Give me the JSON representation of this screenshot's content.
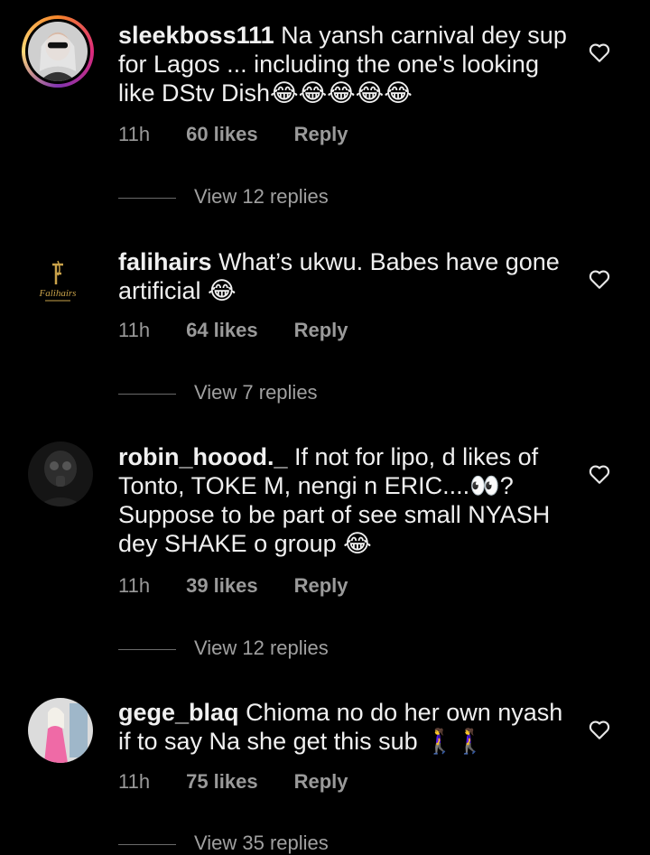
{
  "comments": [
    {
      "username": "sleekboss111",
      "text": "Na yansh carnival dey sup for Lagos ... including the one's looking like DStv Dish😂😂😂😂😂",
      "time": "11h",
      "likes": "60 likes",
      "reply": "Reply",
      "view_replies": "View 12 replies"
    },
    {
      "username": "falihairs",
      "text": "What’s ukwu. Babes have gone artificial 😂",
      "time": "11h",
      "likes": "64 likes",
      "reply": "Reply",
      "view_replies": "View 7 replies",
      "avatar_text": "Falihairs"
    },
    {
      "username": "robin_hoood._",
      "text": "If not for lipo, d likes of Tonto, TOKE M, nengi n ERIC....👀? Suppose to be part of see small NYASH dey SHAKE o group 😂",
      "time": "11h",
      "likes": "39 likes",
      "reply": "Reply",
      "view_replies": "View 12 replies"
    },
    {
      "username": "gege_blaq",
      "text": "Chioma no do her own nyash if to say Na she get this sub 🚶‍♀️🚶‍♀️",
      "time": "11h",
      "likes": "75 likes",
      "reply": "Reply",
      "view_replies": "View 35 replies"
    }
  ],
  "colors": {
    "background": "#000000",
    "text": "#f0f0f0",
    "muted": "#9a9a9a"
  },
  "icons": {
    "like": "heart-outline-icon"
  }
}
